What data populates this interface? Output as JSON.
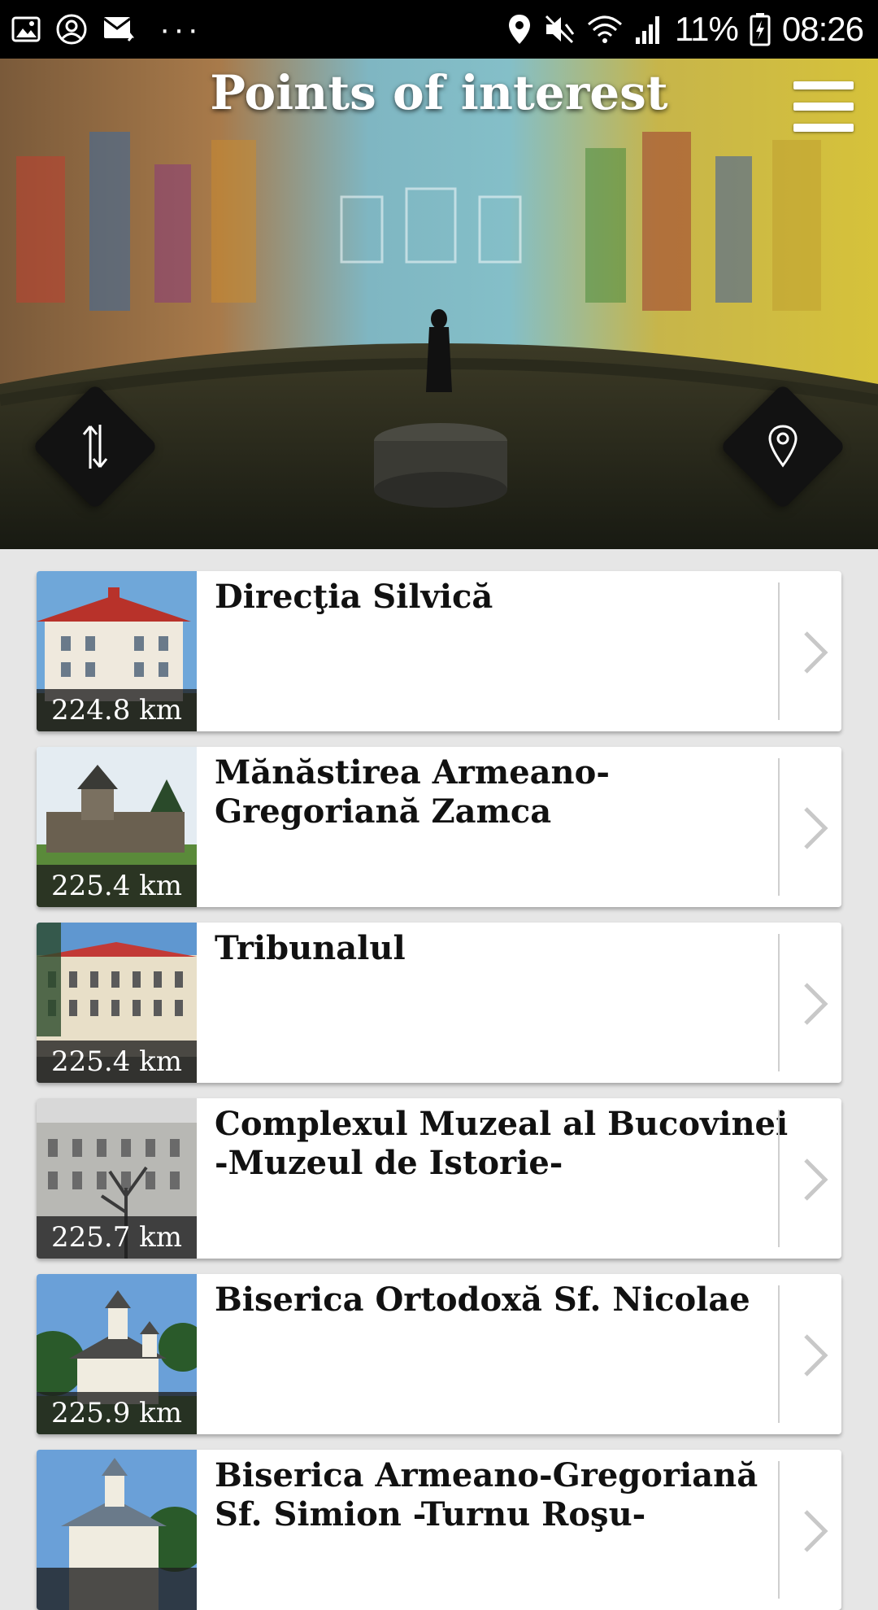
{
  "status_bar": {
    "left_icons": [
      "image-icon",
      "account-circle-icon",
      "mail-forward-icon",
      "more-dots-icon"
    ],
    "battery": "11%",
    "time": "08:26",
    "right_icons": [
      "location-pin-icon",
      "mute-icon",
      "wifi-icon",
      "signal-icon",
      "battery-charging-icon"
    ]
  },
  "header": {
    "title": "Points of interest",
    "menu_icon": "hamburger-menu-icon",
    "sort_icon": "sort-arrows-icon",
    "map_icon": "map-pin-icon"
  },
  "places": [
    {
      "name": "Direcţia Silvică",
      "distance": "224.8 km"
    },
    {
      "name": "Mănăstirea Armeano-Gregoriană Zamca",
      "distance": "225.4 km"
    },
    {
      "name": "Tribunalul",
      "distance": "225.4 km"
    },
    {
      "name": "Complexul Muzeal al Bucovinei -Muzeul de Istorie-",
      "distance": "225.7 km"
    },
    {
      "name": "Biserica Ortodoxă Sf. Nicolae",
      "distance": "225.9 km"
    },
    {
      "name": "Biserica Armeano-Gregoriană Sf. Simion -Turnu Roşu-",
      "distance": ""
    }
  ],
  "colors": {
    "status_bar_bg": "#000000",
    "list_bg": "#e6e6e6",
    "card_bg": "#ffffff",
    "title_text": "#111111",
    "chevron": "#c8c8c8"
  }
}
